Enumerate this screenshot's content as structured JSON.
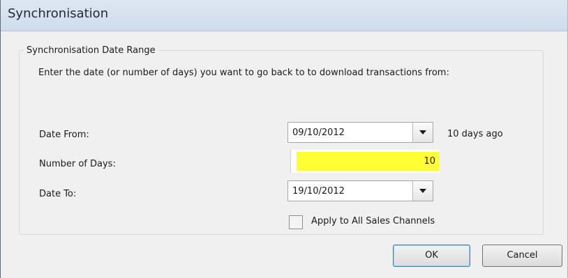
{
  "window": {
    "title": "Synchronisation"
  },
  "group": {
    "legend": "Synchronisation Date Range",
    "instructions": "Enter the date (or number of days) you want to go back to to download transactions from:"
  },
  "date_from": {
    "label": "Date From:",
    "value": "09/10/2012",
    "suffix": "10 days ago"
  },
  "number_of_days": {
    "label": "Number of Days:",
    "value": "10",
    "highlight_color": "#ffff33"
  },
  "date_to": {
    "label": "Date To:",
    "value": "19/10/2012"
  },
  "apply_all": {
    "label": "Apply to All Sales Channels",
    "checked": false
  },
  "buttons": {
    "ok": "OK",
    "cancel": "Cancel"
  },
  "icons": {
    "dropdown": "chevron-down-icon"
  }
}
